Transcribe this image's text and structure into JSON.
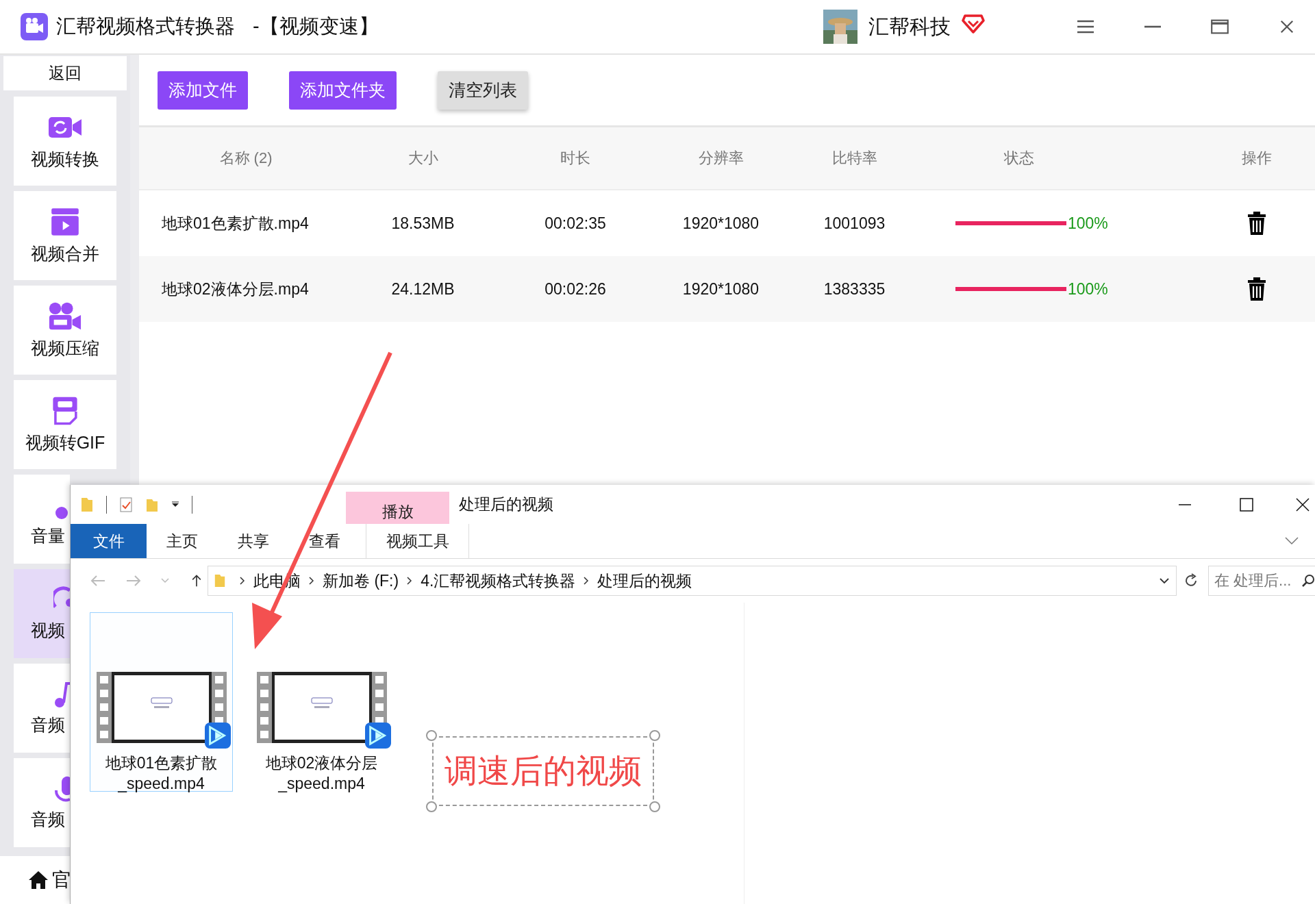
{
  "window": {
    "title": "汇帮视频格式转换器",
    "subtitle": "-【视频变速】"
  },
  "account": {
    "name": "汇帮科技"
  },
  "sidebar": {
    "back": "返回",
    "footer": "官",
    "items": [
      {
        "label": "视频转换",
        "cut": false,
        "selected": false
      },
      {
        "label": "视频合并",
        "cut": false,
        "selected": false
      },
      {
        "label": "视频压缩",
        "cut": false,
        "selected": false
      },
      {
        "label": "视频转GIF",
        "cut": false,
        "selected": false
      },
      {
        "label": "音量",
        "cut": true,
        "selected": false
      },
      {
        "label": "视频",
        "cut": true,
        "selected": true
      },
      {
        "label": "音频",
        "cut": true,
        "selected": false
      },
      {
        "label": "音频",
        "cut": true,
        "selected": false
      }
    ]
  },
  "toolbar": [
    {
      "label": "添加文件",
      "kind": "primary"
    },
    {
      "label": "添加文件夹",
      "kind": "primary"
    },
    {
      "label": "清空列表",
      "kind": "secondary"
    }
  ],
  "table": {
    "columns": [
      "名称 (2)",
      "大小",
      "时长",
      "分辨率",
      "比特率",
      "状态",
      "操作"
    ],
    "rows": [
      {
        "name": "地球01色素扩散.mp4",
        "size": "18.53MB",
        "duration": "00:02:35",
        "resolution": "1920*1080",
        "bitrate": "1001093",
        "level": 1,
        "progress": "100%"
      },
      {
        "name": "地球02液体分层.mp4",
        "size": "24.12MB",
        "duration": "00:02:26",
        "resolution": "1920*1080",
        "bitrate": "1383335",
        "level": 1,
        "progress": "100%"
      }
    ]
  },
  "explorer": {
    "title": "处理后的视频",
    "context_tab": "播放",
    "ribbon_tabs": [
      {
        "label": "文件",
        "selected": true
      },
      {
        "label": "主页",
        "selected": false
      },
      {
        "label": "共享",
        "selected": false
      },
      {
        "label": "查看",
        "selected": false
      },
      {
        "label": "视频工具",
        "selected": false
      }
    ],
    "breadcrumbs": [
      "此电脑",
      "新加卷 (F:)",
      "4.汇帮视频格式转换器",
      "处理后的视频"
    ],
    "search": {
      "placeholder": "在 处理后..."
    },
    "files": [
      {
        "name_lines": [
          "地球01色素扩散",
          "_speed.mp4"
        ],
        "selected": true
      },
      {
        "name_lines": [
          "地球02液体分层",
          "_speed.mp4"
        ],
        "selected": false
      }
    ]
  },
  "annotation": {
    "text": "调速后的视频"
  }
}
